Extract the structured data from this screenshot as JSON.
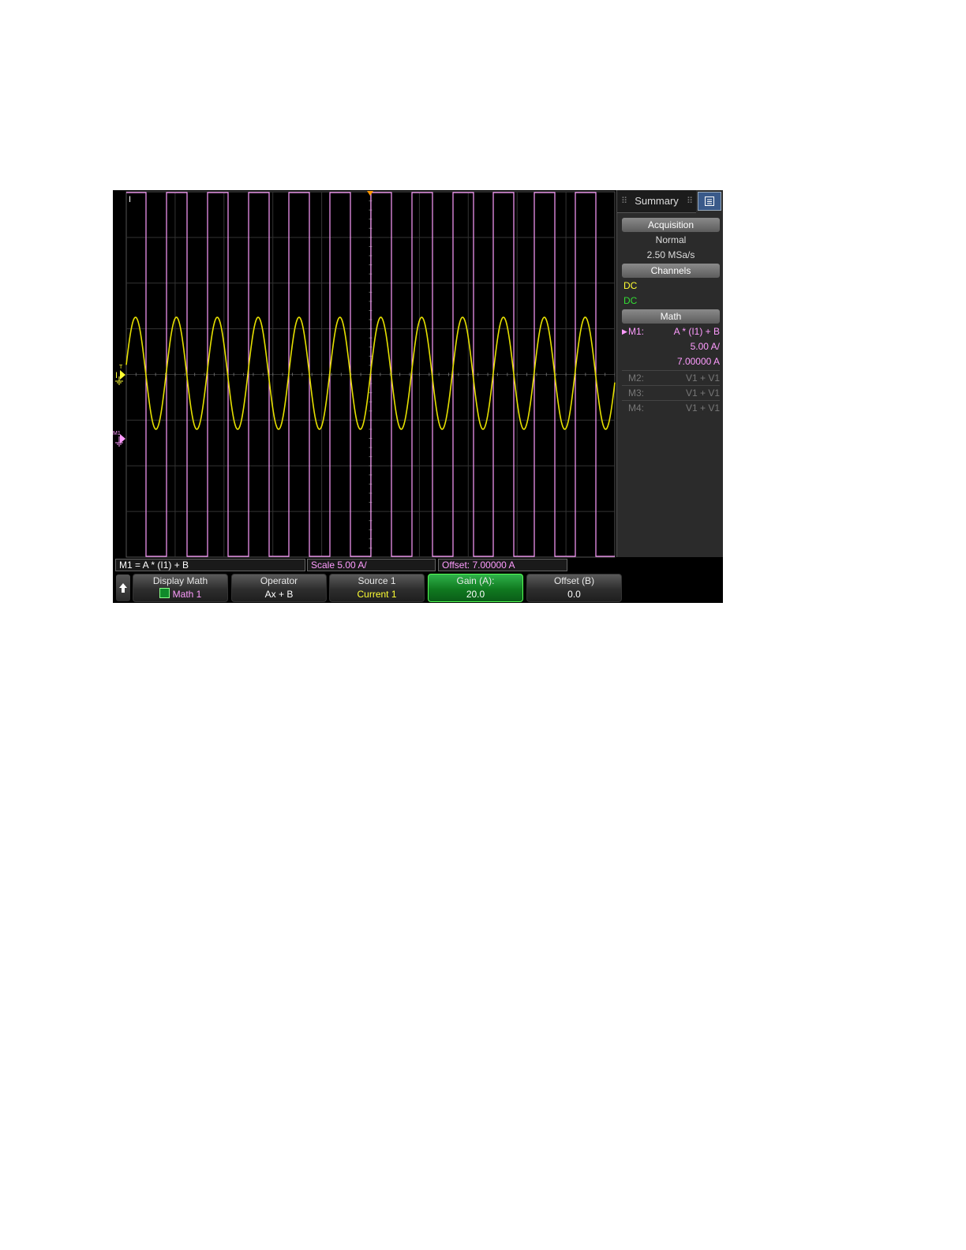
{
  "panel": {
    "tab_label": "Summary",
    "acquisition": {
      "header": "Acquisition",
      "mode": "Normal",
      "rate": "2.50 MSa/s"
    },
    "channels": {
      "header": "Channels",
      "coupling": [
        "DC",
        "DC"
      ]
    },
    "math": {
      "header": "Math",
      "m1": {
        "label": "M1:",
        "expr": "A * (I1) + B",
        "scale": "5.00 A/",
        "offset": "7.00000 A"
      },
      "others": [
        {
          "label": "M2:",
          "expr": "V1 + V1"
        },
        {
          "label": "M3:",
          "expr": "V1 + V1"
        },
        {
          "label": "M4:",
          "expr": "V1 + V1"
        }
      ]
    }
  },
  "status_bar": {
    "formula": "M1 = A * (I1) + B",
    "scale": "Scale  5.00 A/",
    "offset": "Offset: 7.00000 A"
  },
  "softkeys": {
    "display_math": {
      "title": "Display Math",
      "value": "Math 1"
    },
    "operator": {
      "title": "Operator",
      "value": "Ax + B"
    },
    "source": {
      "title": "Source 1",
      "value": "Current 1"
    },
    "gain": {
      "title": "Gain (A):",
      "value": "20.0"
    },
    "offset": {
      "title": "Offset (B)",
      "value": "0.0"
    }
  },
  "markers": {
    "channel": "I",
    "math": "M1",
    "top_label": "I"
  },
  "colors": {
    "channel_trace": "#e6e000",
    "math_trace": "#ff9cff",
    "channel_text": "#ffff33",
    "dc2_text": "#33dd33",
    "math_text": "#ff9cff",
    "trigger": "#ff9900",
    "active_softkey": "#1a9a2e"
  },
  "icons": [
    "up-arrow-icon",
    "menu-icon",
    "trigger-marker-icon",
    "ground-icon",
    "checkbox-icon"
  ]
}
